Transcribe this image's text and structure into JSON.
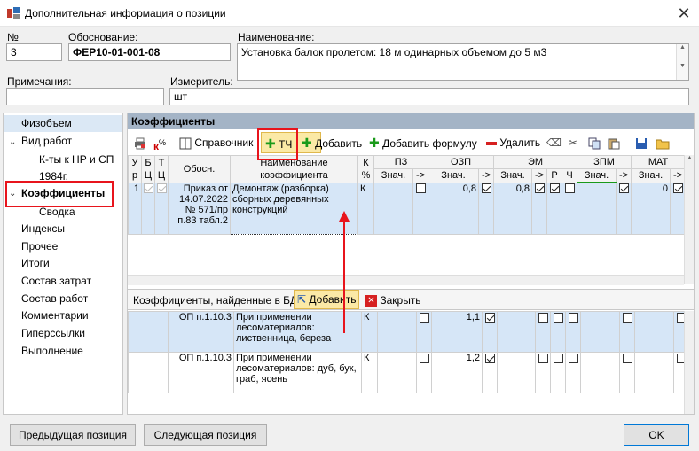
{
  "window": {
    "title": "Дополнительная информация о позиции",
    "close_glyph": "✕"
  },
  "fields": {
    "num_label": "№",
    "num_value": "3",
    "basis_label": "Обоснование:",
    "basis_value": "ФЕР10-01-001-08",
    "name_label": "Наименование:",
    "name_value": "Установка балок пролетом: 18 м одинарных объемом до 5 м3",
    "notes_label": "Примечания:",
    "notes_value": "",
    "unit_label": "Измеритель:",
    "unit_value": "шт"
  },
  "nav": {
    "items": [
      "Физобъем",
      "Вид работ",
      "К-ты к НР и СП",
      "1984г.",
      "Коэффициенты",
      "Сводка",
      "Индексы",
      "Прочее",
      "Итоги",
      "Состав затрат",
      "Состав работ",
      "Комментарии",
      "Гиперссылки",
      "Выполнение"
    ]
  },
  "panel": {
    "title": "Коэффициенты",
    "toolbar": {
      "tc": "ТЧ",
      "reference": "Справочник",
      "add": "Добавить",
      "add_formula": "Добавить формулу",
      "delete": "Удалить",
      "k_percent": "%"
    },
    "header": {
      "ur": [
        "У",
        "р"
      ],
      "bc": [
        "Б",
        "Ц"
      ],
      "tc": [
        "Т",
        "Ц"
      ],
      "basis": "Обосн.",
      "name": [
        "Наименование",
        "коэффициента"
      ],
      "kp": [
        "К",
        "%"
      ],
      "pz": "ПЗ",
      "ozp": "ОЗП",
      "em": "ЭМ",
      "zpm": "ЗПМ",
      "mat": "МАТ",
      "val": "Знач.",
      "arrow": "->",
      "r": "Р",
      "ch": "Ч"
    },
    "row": {
      "ur": "1",
      "basis": [
        "Приказ от",
        "14.07.2022",
        "№ 571/пр",
        "п.83 табл.2"
      ],
      "name": "Демонтаж (разборка) сборных деревянных конструкций",
      "k": "К",
      "ozp_val": "0,8",
      "em_val": "0,8",
      "mat_val": "0"
    }
  },
  "found": {
    "title": "Коэффициенты, найденные в БД",
    "add": "Добавить",
    "close": "Закрыть",
    "rows": [
      {
        "basis": "ОП п.1.10.3",
        "name": "При применении лесоматериалов: лиственница, береза",
        "k": "К",
        "ozp_val": "1,1"
      },
      {
        "basis": "ОП п.1.10.3",
        "name": "При применении лесоматериалов: дуб, бук, граб, ясень",
        "k": "К",
        "ozp_val": "1,2"
      }
    ]
  },
  "footer": {
    "prev": "Предыдущая позиция",
    "next": "Следующая позиция",
    "ok": "OK"
  },
  "colors": {
    "accent_red": "#e8141c",
    "header_blue": "#a4b4c6",
    "selection": "#d6e6f7"
  }
}
